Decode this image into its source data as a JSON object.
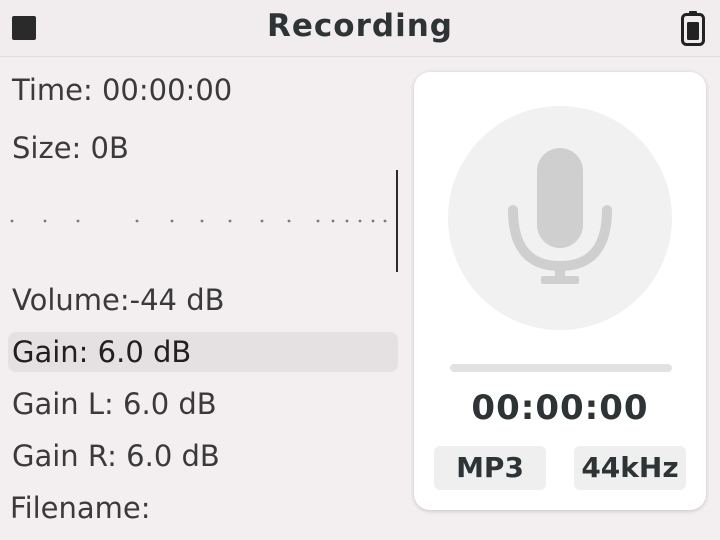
{
  "header": {
    "title": "Recording",
    "stop_icon": "stop-square-icon",
    "battery_icon": "battery-icon"
  },
  "stats": {
    "time_label": "Time:",
    "time_value": "00:00:00",
    "size_label": "Size:",
    "size_value": "0B",
    "volume_label": "Volume:",
    "volume_value": "-44 dB",
    "gain_label": "Gain:",
    "gain_value": "6.0 dB",
    "gain_l_label": "Gain L:",
    "gain_l_value": "6.0 dB",
    "gain_r_label": "Gain R:",
    "gain_r_value": "6.0 dB",
    "filename_label": "Filename:",
    "filename_value": ""
  },
  "recorder": {
    "mic_icon": "microphone-icon",
    "time": "00:00:00",
    "progress_fraction": 0.0,
    "format": "MP3",
    "sample_rate": "44kHz"
  },
  "colors": {
    "background": "#f3eef0",
    "selected_row": "#e5e1e2",
    "card": "#ffffff",
    "mic": "#cfcfcf"
  }
}
